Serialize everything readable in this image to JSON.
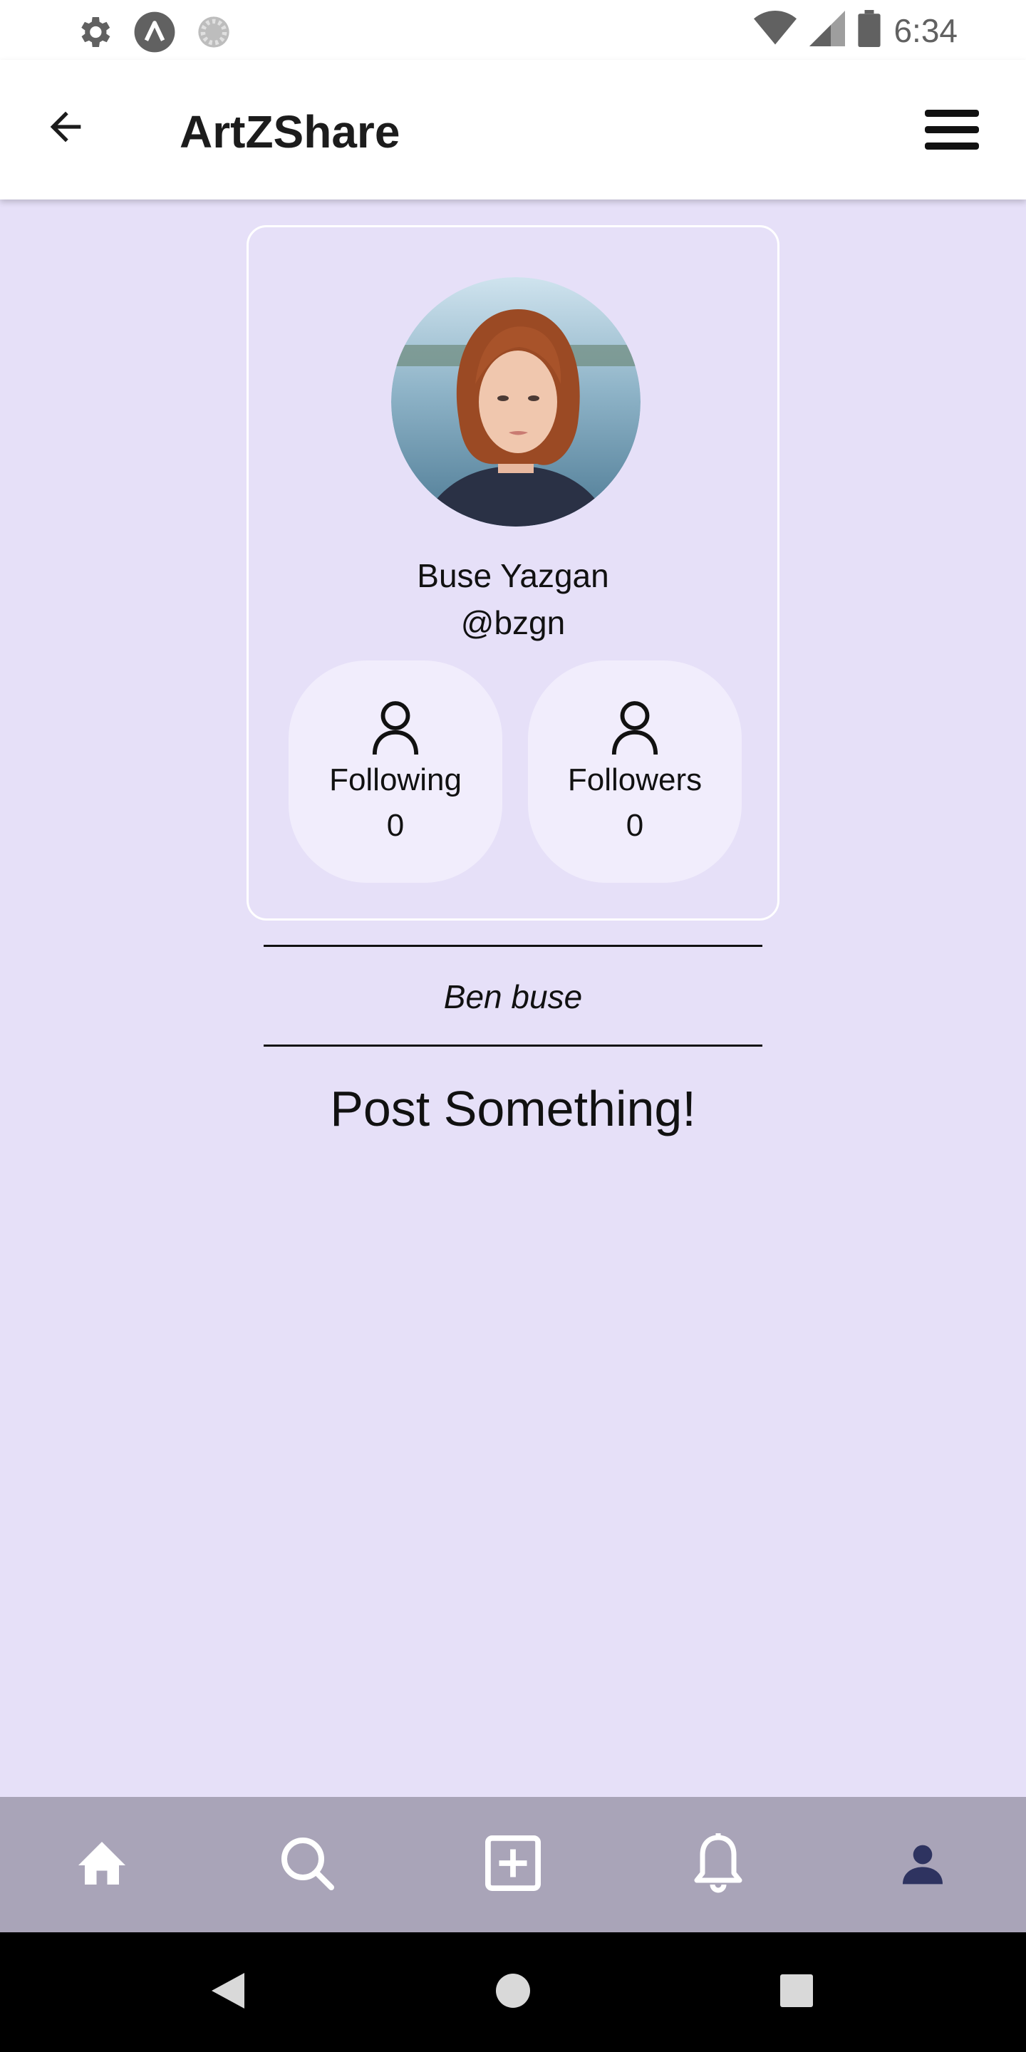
{
  "status_bar": {
    "time": "6:34",
    "left_icons": [
      "gear-icon",
      "app-a-icon",
      "loading-icon"
    ],
    "right_icons": [
      "wifi-icon",
      "signal-icon",
      "battery-icon"
    ]
  },
  "app_bar": {
    "title": "ArtZShare",
    "back_icon": "arrow-back-icon",
    "menu_icon": "hamburger-menu-icon"
  },
  "profile": {
    "name": "Buse Yazgan",
    "handle": "@bzgn",
    "following": {
      "label": "Following",
      "count": "0"
    },
    "followers": {
      "label": "Followers",
      "count": "0"
    },
    "bio": "Ben buse"
  },
  "post_prompt": "Post Something!",
  "bottom_nav": {
    "items": [
      {
        "name": "home",
        "icon": "home-icon",
        "active": false
      },
      {
        "name": "search",
        "icon": "search-icon",
        "active": false
      },
      {
        "name": "create",
        "icon": "add-box-icon",
        "active": false
      },
      {
        "name": "notifications",
        "icon": "bell-icon",
        "active": false
      },
      {
        "name": "profile",
        "icon": "person-icon",
        "active": true
      }
    ]
  },
  "colors": {
    "background": "#e6e0f8",
    "stat_card": "#f1edfc",
    "bottom_nav": "#a9a4b8",
    "active_nav": "#2e3360"
  }
}
